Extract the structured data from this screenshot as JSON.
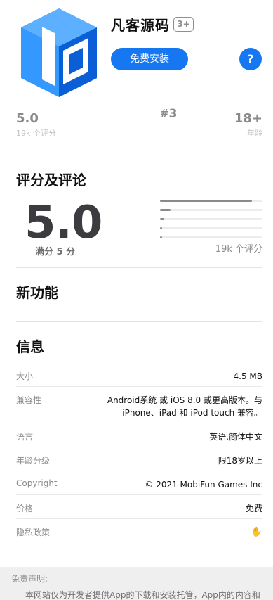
{
  "app": {
    "name": "凡客源码",
    "age_badge": "3+",
    "install_label": "免费安装",
    "help_label": "?"
  },
  "stats": {
    "rating_value": "5.0",
    "rating_count": "19k 个评分",
    "rank_hash": "#",
    "rank_value": "3",
    "age_value": "18+",
    "age_label": "年龄"
  },
  "ratings": {
    "title": "评分及评论",
    "score": "5.0",
    "out_of": "满分 5 分",
    "count": "19k 个评分",
    "distribution": [
      0.9,
      0.1,
      0.04,
      0.02,
      0.02
    ]
  },
  "whats_new": {
    "title": "新功能"
  },
  "info": {
    "title": "信息",
    "rows": [
      {
        "key": "大小",
        "value": "4.5 MB"
      },
      {
        "key": "兼容性",
        "value": "Android系统 或 iOS 8.0 或更高版本。与",
        "value2": "iPhone、iPad 和 iPod touch 兼容。"
      },
      {
        "key": "语言",
        "value": "英语,简体中文"
      },
      {
        "key": "年龄分级",
        "value": "限18岁以上"
      },
      {
        "key": "Copyright",
        "value": "© 2021 MobiFun Games Inc"
      },
      {
        "key": "价格",
        "value": "免费"
      },
      {
        "key": "隐私政策",
        "value": "✋"
      }
    ]
  },
  "disclaimer": {
    "title": "免责声明:",
    "text": "本网站仅为开发者提供App的下载和安装托管，App内的内容和"
  },
  "colors": {
    "accent": "#1577f2",
    "icon_light": "#3399ff",
    "icon_dark": "#0a5fd6"
  }
}
